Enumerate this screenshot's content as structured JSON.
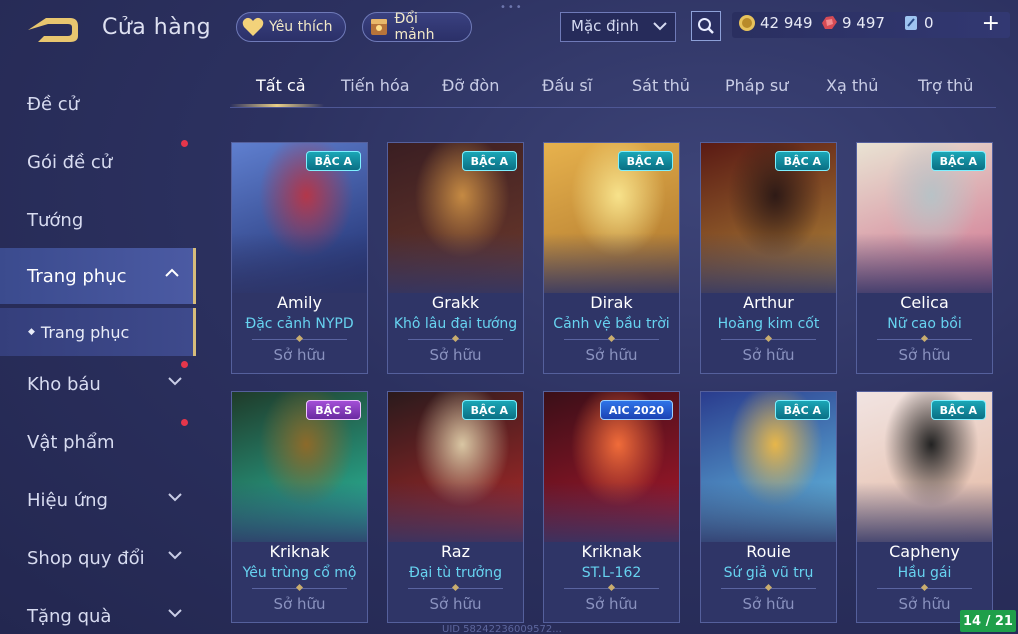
{
  "header": {
    "title": "Cửa hàng",
    "favorites_label": "Yêu thích",
    "fragments_label": "Đổi mảnh",
    "sort": {
      "selected": "Mặc định"
    },
    "currency": {
      "gold": "42 949",
      "vouchers": "9 497",
      "tickets": "0"
    },
    "plus_label": "+"
  },
  "sidebar": {
    "items": [
      {
        "label": "Đề cử"
      },
      {
        "label": "Gói đề cử"
      },
      {
        "label": "Tướng"
      },
      {
        "label": "Trang phục"
      },
      {
        "label": "Kho báu"
      },
      {
        "label": "Vật phẩm"
      },
      {
        "label": "Hiệu ứng"
      },
      {
        "label": "Shop quy đổi"
      },
      {
        "label": "Tặng quà"
      }
    ],
    "sub_item": "Trang phục"
  },
  "tabs": [
    "Tất cả",
    "Tiến hóa",
    "Đỡ đòn",
    "Đấu sĩ",
    "Sát thủ",
    "Pháp sư",
    "Xạ thủ",
    "Trợ thủ"
  ],
  "cards": [
    {
      "hero": "Amily",
      "skin": "Đặc cảnh NYPD",
      "status": "Sở hữu",
      "badge": "BẬC A",
      "badge_type": "a",
      "colors": [
        "#5f7fcf",
        "#1e2c6a",
        "#b3374a"
      ]
    },
    {
      "hero": "Grakk",
      "skin": "Khô lâu đại tướng",
      "status": "Sở hữu",
      "badge": "BẬC A",
      "badge_type": "a",
      "colors": [
        "#3a1e22",
        "#6e3a2c",
        "#c58a43"
      ]
    },
    {
      "hero": "Dirak",
      "skin": "Cảnh vệ bầu trời",
      "status": "Sở hữu",
      "badge": "BẬC A",
      "badge_type": "a",
      "colors": [
        "#e7b24d",
        "#a8702a",
        "#f7e28b"
      ]
    },
    {
      "hero": "Arthur",
      "skin": "Hoàng kim cốt",
      "status": "Sở hữu",
      "badge": "BẬC A",
      "badge_type": "a",
      "colors": [
        "#5a1a14",
        "#b48a3a",
        "#2e1a16"
      ]
    },
    {
      "hero": "Celica",
      "skin": "Nữ cao bồi",
      "status": "Sở hữu",
      "badge": "BẬC A",
      "badge_type": "a",
      "colors": [
        "#e9e3d3",
        "#cf6d8c",
        "#b8c2c6"
      ]
    },
    {
      "hero": "Kriknak",
      "skin": "Yêu trùng cổ mộ",
      "status": "Sở hữu",
      "badge": "BẬC S",
      "badge_type": "s",
      "colors": [
        "#1f3b2a",
        "#2bc3a6",
        "#8c6a2a"
      ]
    },
    {
      "hero": "Raz",
      "skin": "Đại tù trưởng",
      "status": "Sở hữu",
      "badge": "BẬC A",
      "badge_type": "a",
      "colors": [
        "#2a1a1c",
        "#b52a2a",
        "#d9c6a3"
      ]
    },
    {
      "hero": "Kriknak",
      "skin": "ST.L-162",
      "status": "Sở hữu",
      "badge": "AIC 2020",
      "badge_type": "aic",
      "colors": [
        "#3a0f18",
        "#b0182c",
        "#f06c3a"
      ]
    },
    {
      "hero": "Rouie",
      "skin": "Sứ giả vũ trụ",
      "status": "Sở hữu",
      "badge": "BẬC A",
      "badge_type": "a",
      "colors": [
        "#2a3c8e",
        "#69c8e8",
        "#e7b64a"
      ]
    },
    {
      "hero": "Capheny",
      "skin": "Hầu gái",
      "status": "Sở hữu",
      "badge": "BẬC A",
      "badge_type": "a",
      "colors": [
        "#f1e4e2",
        "#e4b7a0",
        "#222222"
      ]
    }
  ],
  "pagination": "14 / 21",
  "uid_text": "UID 58242236009572..."
}
